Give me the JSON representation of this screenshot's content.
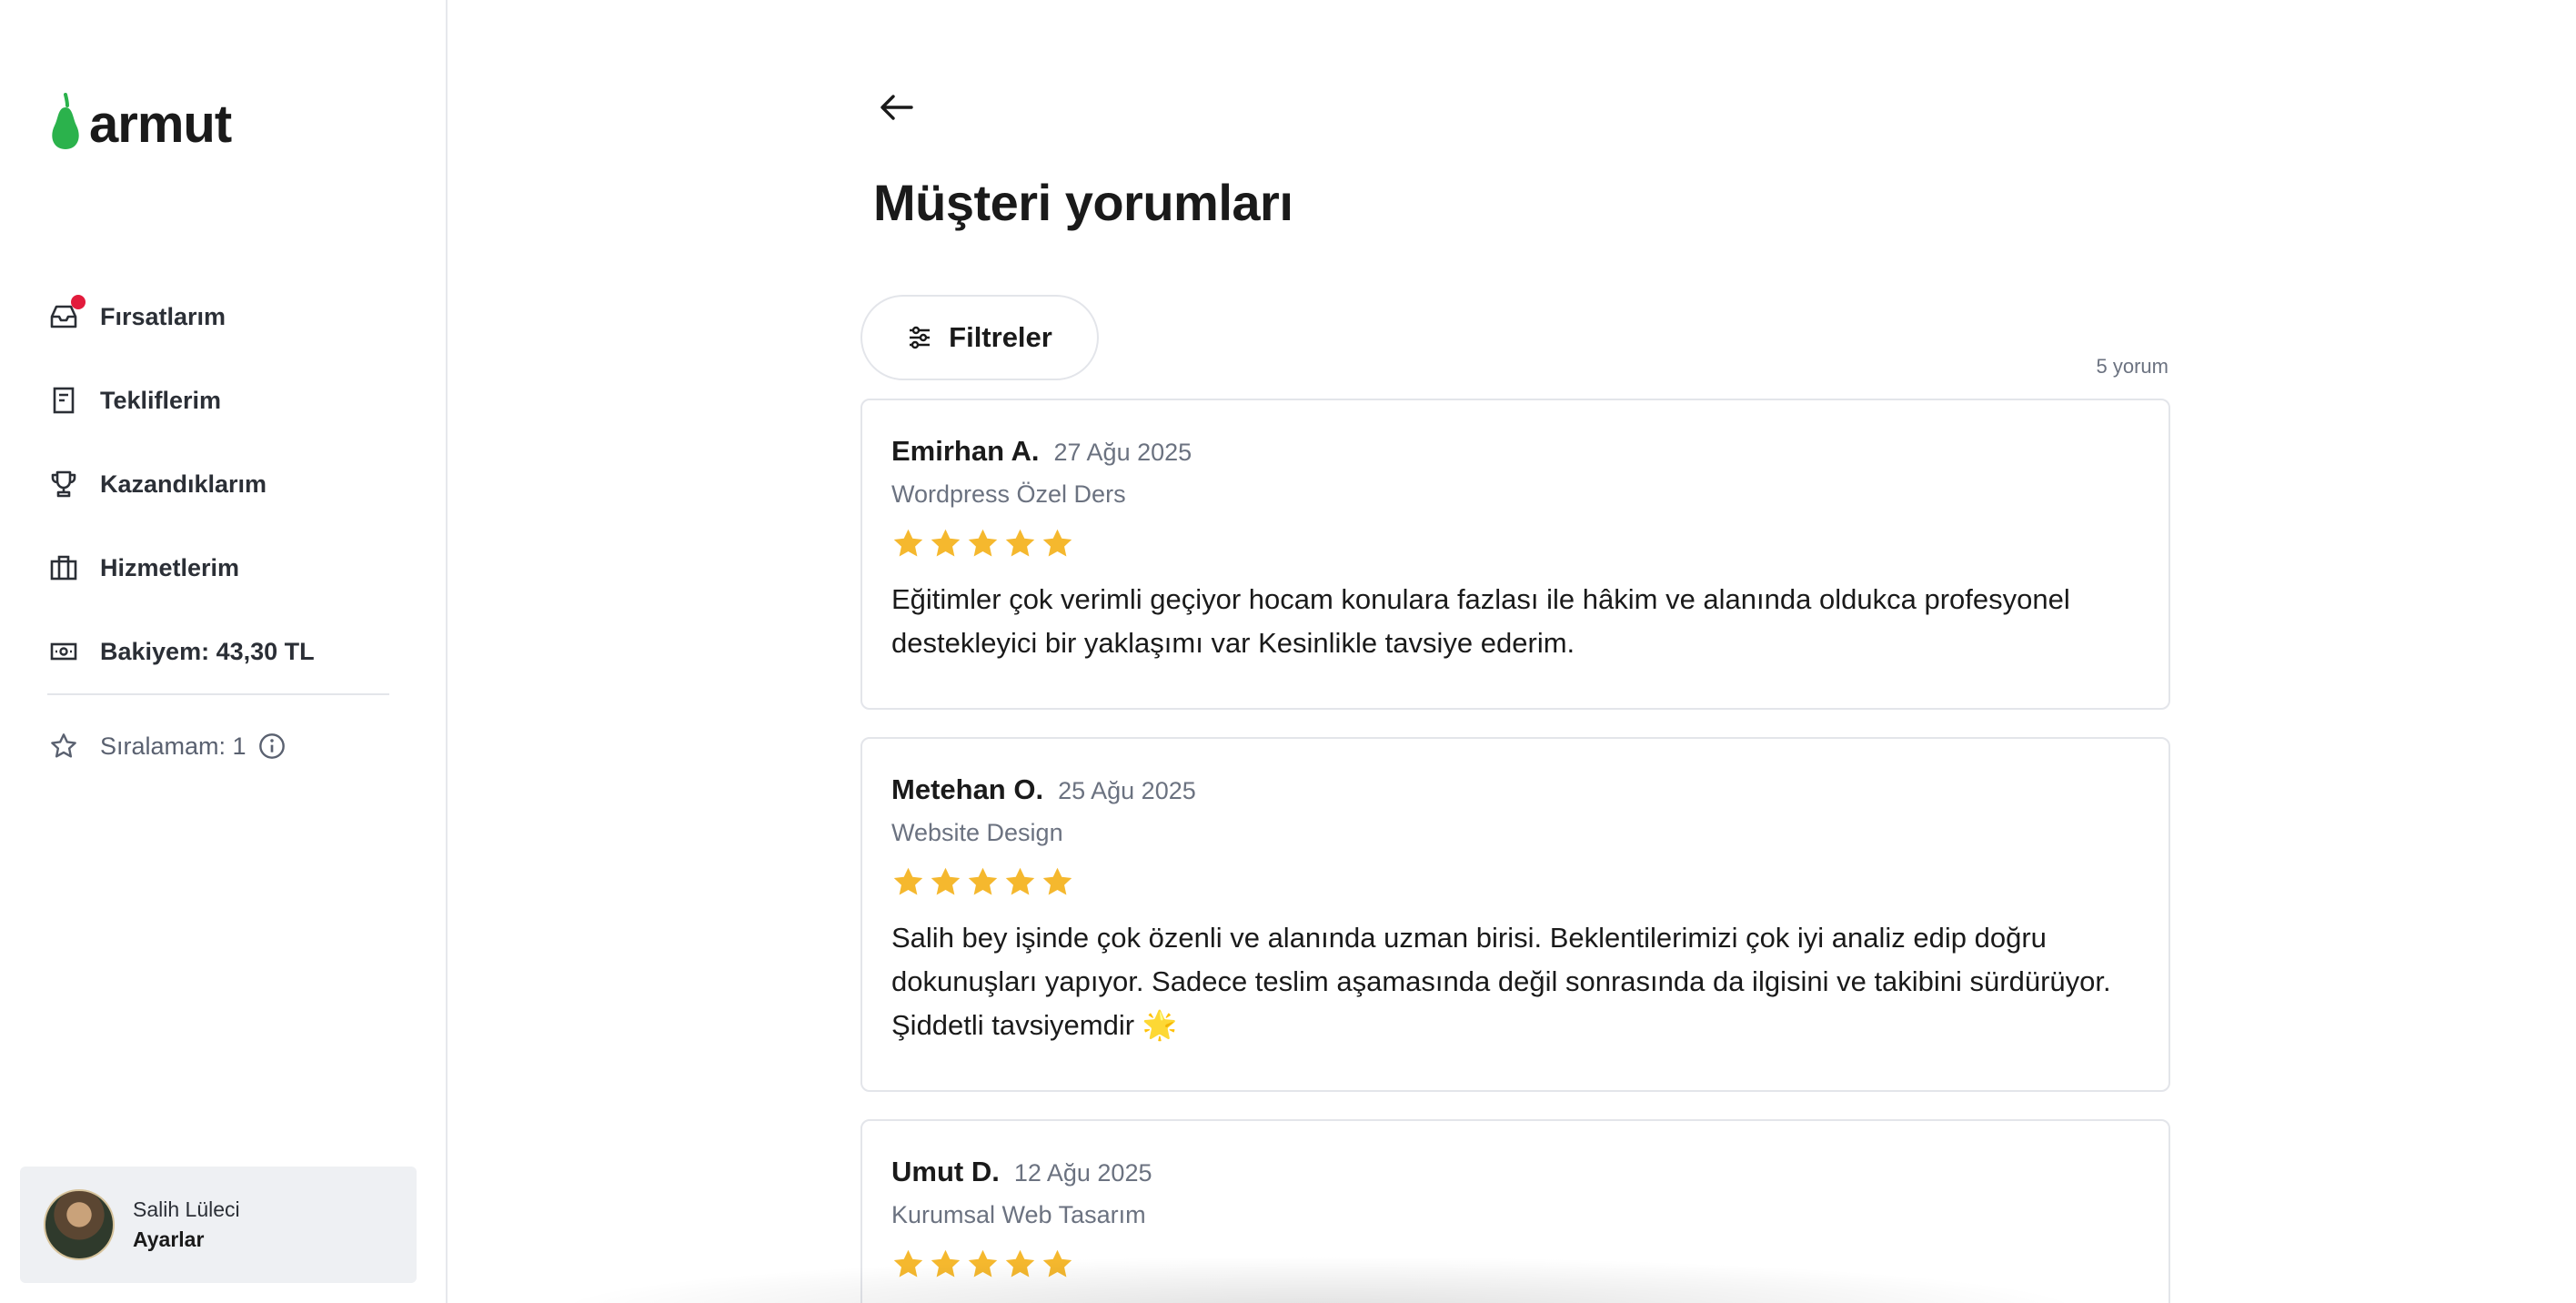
{
  "brand": {
    "name": "armut",
    "accent": "#2bb24c"
  },
  "sidebar": {
    "items": [
      {
        "label": "Fırsatlarım",
        "icon": "inbox-icon",
        "has_notification": true
      },
      {
        "label": "Tekliflerim",
        "icon": "document-icon"
      },
      {
        "label": "Kazandıklarım",
        "icon": "trophy-icon"
      },
      {
        "label": "Hizmetlerim",
        "icon": "briefcase-icon"
      },
      {
        "label": "Bakiyem: 43,30 TL",
        "icon": "money-icon"
      }
    ],
    "rank_label": "Sıralamam: 1",
    "user": {
      "name": "Salih Lüleci",
      "settings_label": "Ayarlar"
    }
  },
  "main": {
    "title": "Müşteri yorumları",
    "filters_label": "Filtreler",
    "count_label": "5 yorum",
    "star_color": "#f5b82e",
    "reviews": [
      {
        "name": "Emirhan A.",
        "date": "27 Ağu 2025",
        "service": "Wordpress Özel Ders",
        "rating": 5,
        "text": "Eğitimler çok verimli geçiyor hocam konulara fazlası ile hâkim ve alanında oldukca profesyonel destekleyici bir yaklaşımı var Kesinlikle tavsiye ederim."
      },
      {
        "name": "Metehan O.",
        "date": "25 Ağu 2025",
        "service": "Website Design",
        "rating": 5,
        "text": "Salih bey işinde çok özenli ve alanında uzman birisi. Beklentilerimizi çok iyi analiz edip doğru dokunuşları yapıyor. Sadece teslim aşamasında değil sonrasında da ilgisini ve takibini sürdürüyor. Şiddetli tavsiyemdir 🌟"
      },
      {
        "name": "Umut D.",
        "date": "12 Ağu 2025",
        "service": "Kurumsal Web Tasarım",
        "rating": 5,
        "text": ""
      }
    ]
  }
}
